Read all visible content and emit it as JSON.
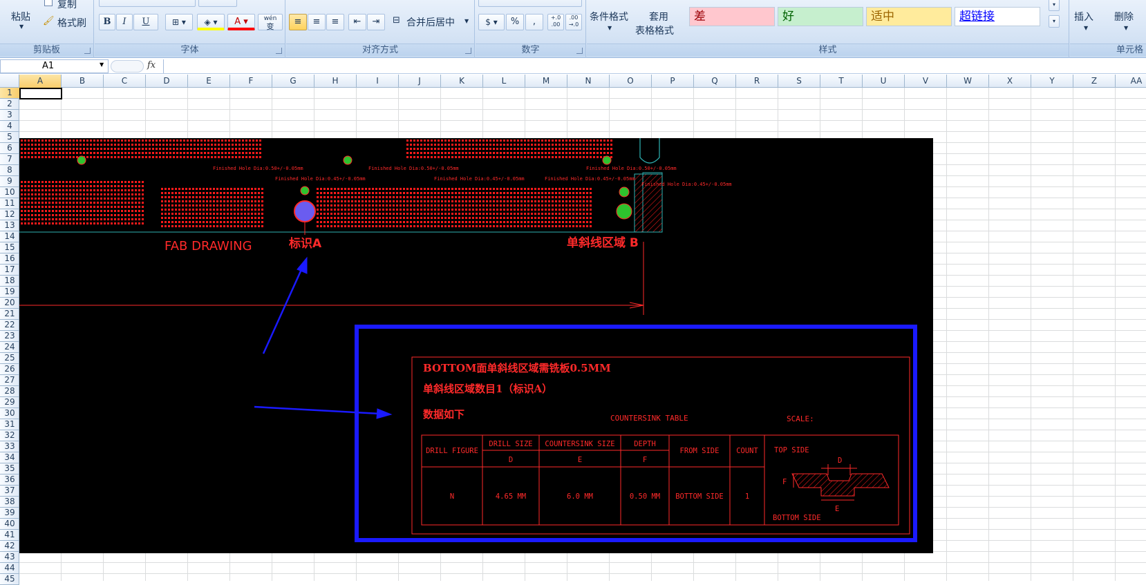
{
  "ribbon": {
    "clipboard": {
      "paste": "粘贴",
      "copy": "复制",
      "format_painter": "格式刷",
      "label": "剪贴板"
    },
    "font": {
      "bold": "B",
      "italic": "I",
      "underline": "U",
      "font_color": "A",
      "label": "字体",
      "wen": "wén",
      "bian": "变"
    },
    "alignment": {
      "merge_center": "合并后居中",
      "label": "对齐方式"
    },
    "number": {
      "percent": "%",
      "comma": ",",
      "inc_decimal": "+.0\n.00",
      "dec_decimal": ".00\n→.0",
      "label": "数字"
    },
    "styles": {
      "conditional": "条件格式",
      "table_format_1": "套用",
      "table_format_2": "表格格式",
      "bad": "差",
      "good": "好",
      "neutral": "适中",
      "hyperlink": "超链接",
      "label": "样式"
    },
    "cells": {
      "insert": "插入",
      "delete": "删除",
      "label": "单元格"
    }
  },
  "formula_bar": {
    "name_box": "A1",
    "fx": "fx"
  },
  "columns": [
    "A",
    "B",
    "C",
    "D",
    "E",
    "F",
    "G",
    "H",
    "I",
    "J",
    "K",
    "L",
    "M",
    "N",
    "O",
    "P",
    "Q",
    "R",
    "S",
    "T",
    "U",
    "V",
    "W",
    "X",
    "Y",
    "Z",
    "AA"
  ],
  "rows": [
    "1",
    "2",
    "3",
    "4",
    "5",
    "6",
    "7",
    "8",
    "9",
    "10",
    "11",
    "12",
    "13",
    "14",
    "15",
    "16",
    "17",
    "18",
    "19",
    "20",
    "21",
    "22",
    "23",
    "24",
    "25",
    "26",
    "27",
    "28",
    "29",
    "30",
    "31",
    "32",
    "33",
    "34",
    "35",
    "36",
    "37",
    "38",
    "39",
    "40",
    "41",
    "42",
    "43",
    "44",
    "45"
  ],
  "drawing": {
    "fab_drawing": "FAB DRAWING",
    "mark_a": "标识A",
    "region_b": "单斜线区域 B",
    "hole_note_1": "Finished Hole Dia:0.50+/-0.05mm",
    "hole_note_2": "Finished Hole Dia:0.45+/-0.05mm",
    "title_line_1": "BOTTOM面单斜线区域需铣板0.5MM",
    "title_line_2": "单斜线区域数目1（标识A）",
    "title_line_3": "数据如下",
    "table_title": "COUNTERSINK TABLE",
    "scale": "SCALE:",
    "table": {
      "headers": [
        "DRILL FIGURE",
        "DRILL SIZE",
        "COUNTERSINK SIZE",
        "DEPTH",
        "FROM SIDE",
        "COUNT"
      ],
      "subheaders": [
        "D",
        "E",
        "F"
      ],
      "row": [
        "N",
        "4.65 MM",
        "6.0 MM",
        "0.50 MM",
        "BOTTOM SIDE",
        "1"
      ]
    },
    "detail": {
      "top_side": "TOP SIDE",
      "bottom_side": "BOTTOM SIDE",
      "d": "D",
      "e": "E",
      "f": "F"
    }
  }
}
